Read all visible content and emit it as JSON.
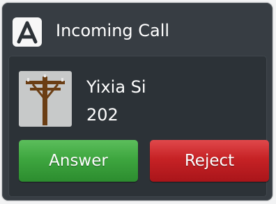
{
  "dialog": {
    "title": "Incoming Call",
    "logo_icon": "app-logo-icon"
  },
  "caller": {
    "name": "Yixia Si",
    "number": "202",
    "avatar_icon": "utility-pole-icon"
  },
  "buttons": {
    "answer_label": "Answer",
    "reject_label": "Reject"
  },
  "colors": {
    "dialog_background": "#373d43",
    "panel_background": "#2c3237",
    "answer": "#3ea63f",
    "reject": "#c62225",
    "text": "#ffffff"
  }
}
